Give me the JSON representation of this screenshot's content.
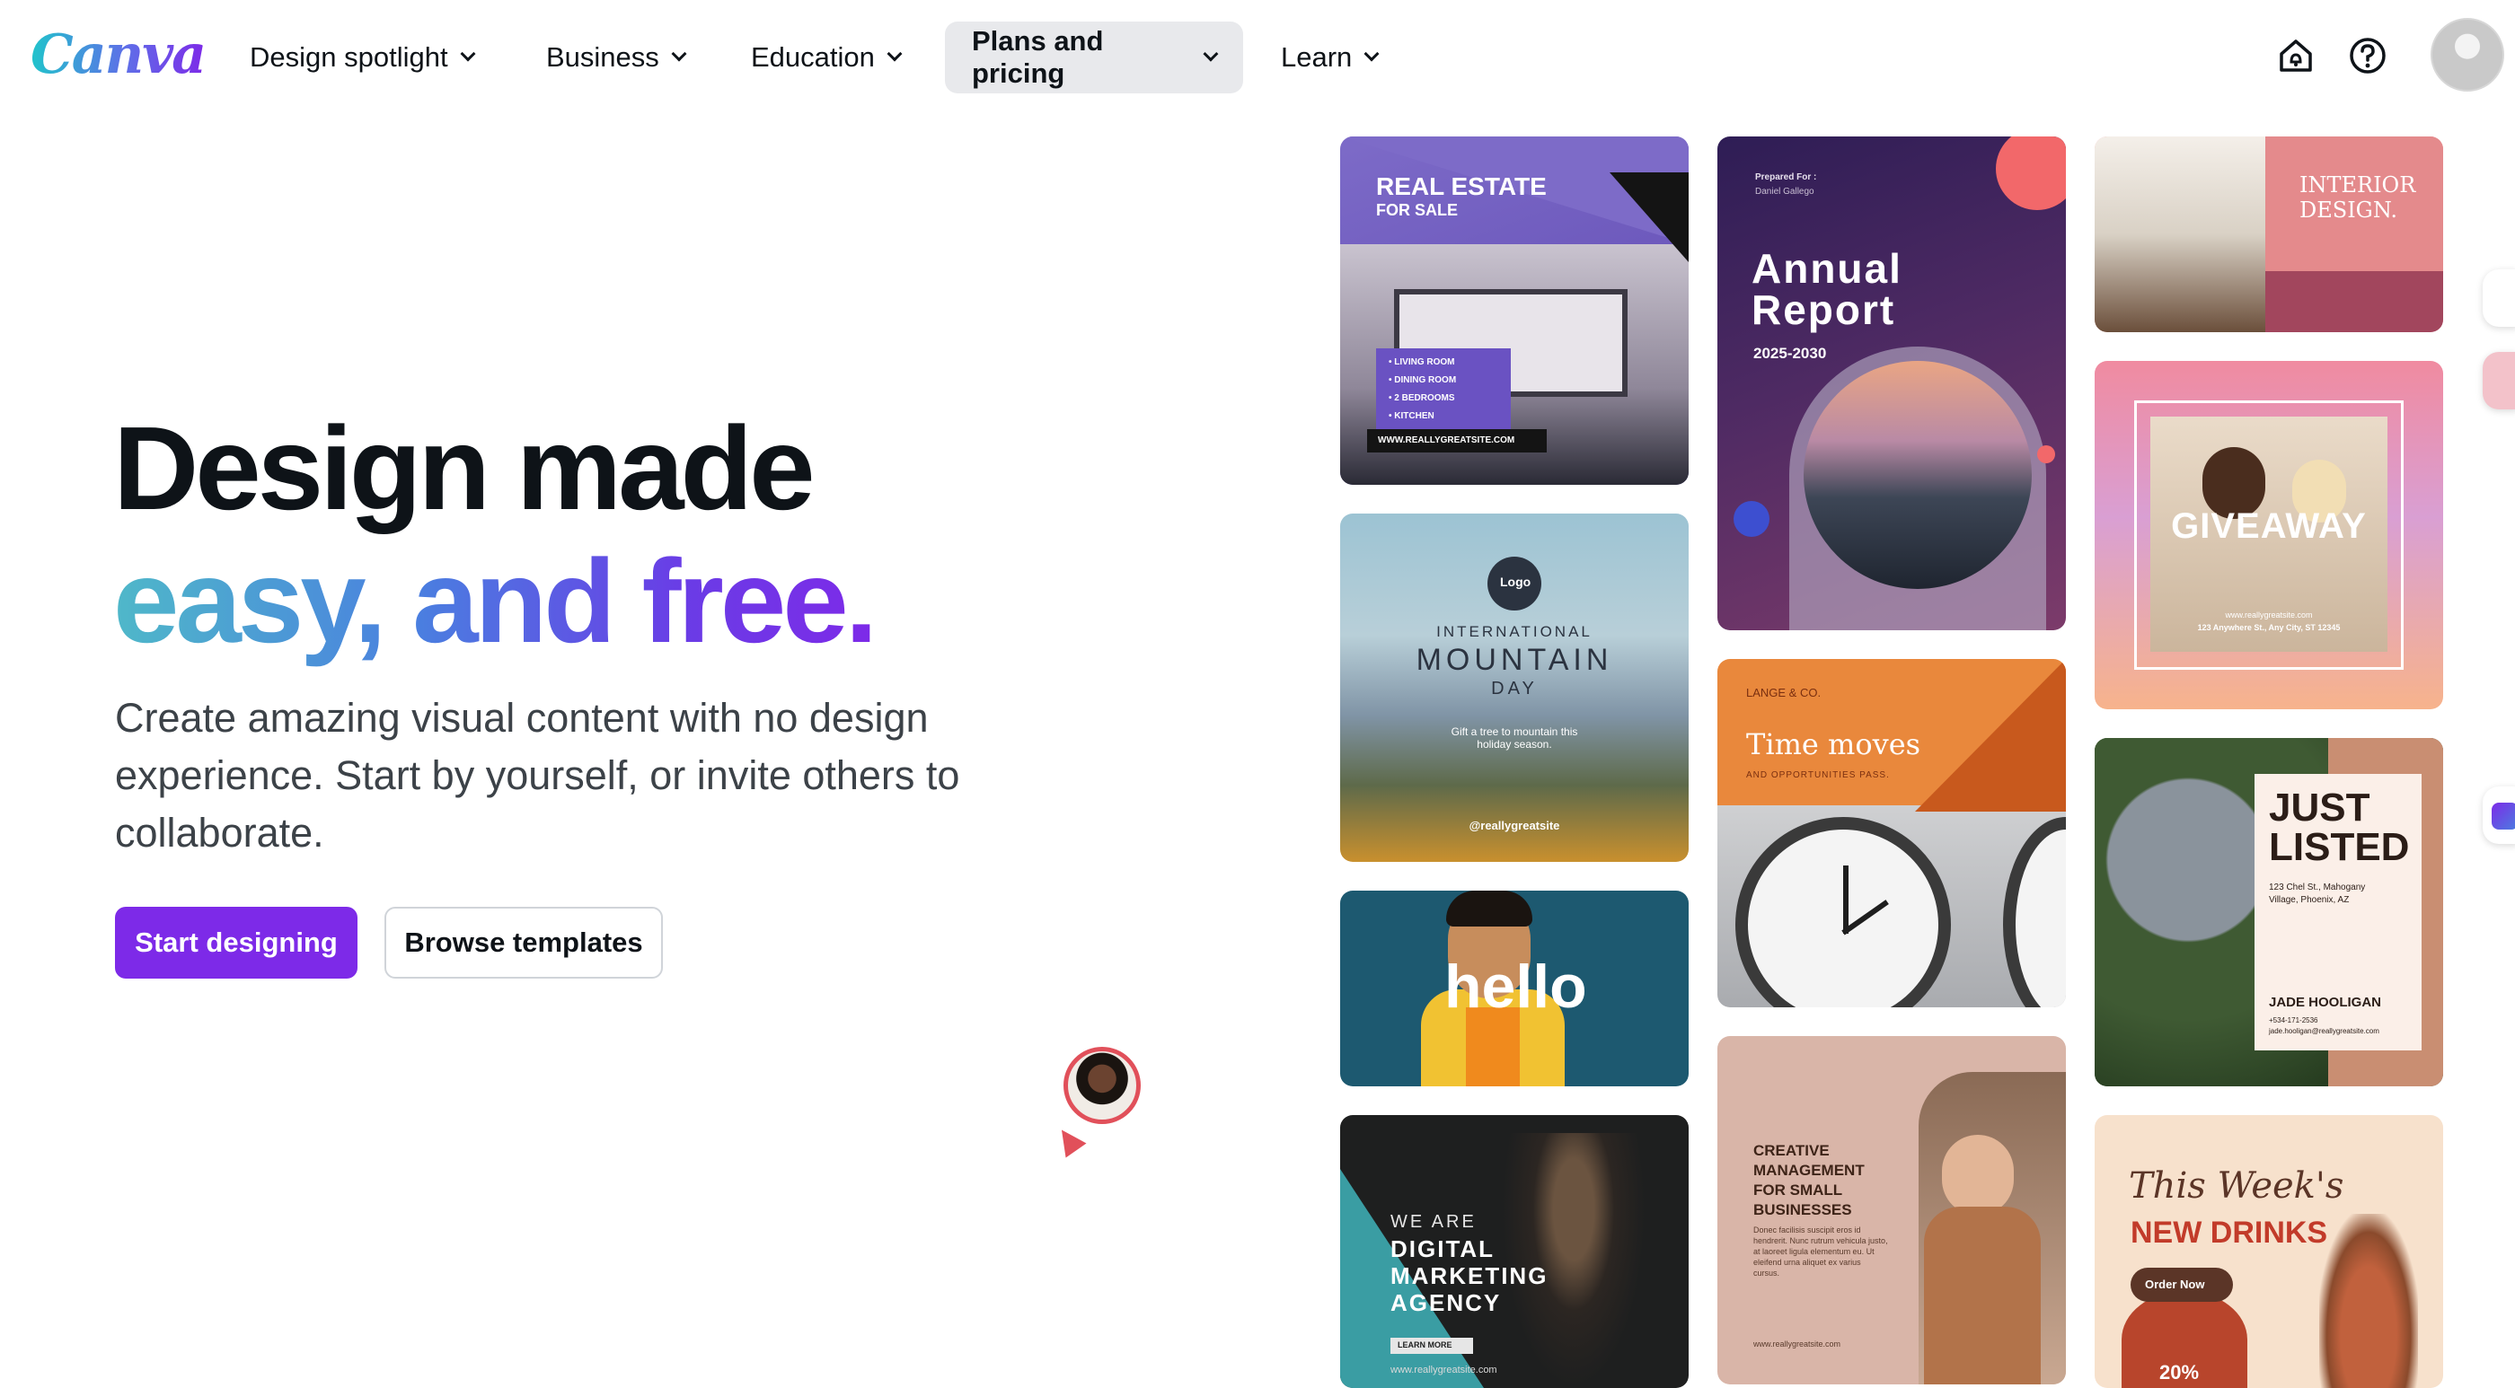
{
  "brand": {
    "logo_text": "Canva"
  },
  "nav": {
    "items": [
      {
        "label": "Design spotlight",
        "has_dropdown": true,
        "active": false
      },
      {
        "label": "Business",
        "has_dropdown": true,
        "active": false
      },
      {
        "label": "Education",
        "has_dropdown": true,
        "active": false
      },
      {
        "label": "Plans and pricing",
        "has_dropdown": true,
        "active": true
      },
      {
        "label": "Learn",
        "has_dropdown": true,
        "active": false
      }
    ],
    "icons": [
      "home-notification-icon",
      "help-icon"
    ],
    "avatar": "user-avatar"
  },
  "hero": {
    "line1": "Design made",
    "line2": "easy, and free.",
    "subtitle": "Create amazing visual content with no design experience. Start by yourself, or invite others to collaborate.",
    "primary_cta": "Start designing",
    "secondary_cta": "Browse templates"
  },
  "templates": {
    "real_estate": {
      "title": "REAL ESTATE",
      "subtitle": "FOR SALE",
      "bullets": [
        "• LIVING ROOM",
        "• DINING ROOM",
        "• 2 BEDROOMS",
        "• KITCHEN"
      ],
      "url": "WWW.REALLYGREATSITE.COM"
    },
    "mountain": {
      "logo": "Logo",
      "line1": "INTERNATIONAL",
      "line2": "MOUNTAIN",
      "line3": "DAY",
      "tagline": "Gift a tree to mountain this holiday season.",
      "handle": "@reallygreatsite"
    },
    "hello": {
      "text": "hello"
    },
    "agency": {
      "line1": "WE ARE",
      "line2": "DIGITAL",
      "line3": "MARKETING",
      "line4": "AGENCY",
      "cta": "LEARN MORE",
      "url": "www.reallygreatsite.com"
    },
    "annual_report": {
      "prepared_for": "Prepared For :",
      "name": "Daniel Gallego",
      "title1": "Annual",
      "title2": "Report",
      "years": "2025-2030"
    },
    "time_moves": {
      "brand": "LANGE & CO.",
      "title": "Time moves",
      "subtitle": "AND OPPORTUNITIES PASS."
    },
    "creative": {
      "line1": "CREATIVE",
      "line2": "MANAGEMENT",
      "line3": "FOR SMALL",
      "line4": "BUSINESSES",
      "body": "Donec facilisis suscipit eros id hendrerit. Nunc rutrum vehicula justo, at laoreet ligula elementum eu. Ut eleifend urna aliquet ex varius cursus.",
      "url": "www.reallygreatsite.com"
    },
    "interior": {
      "title1": "INTERIOR",
      "title2": "DESIGN."
    },
    "giveaway": {
      "title": "GIVEAWAY",
      "url": "www.reallygreatsite.com",
      "address": "123 Anywhere St., Any City, ST 12345"
    },
    "just_listed": {
      "title1": "JUST",
      "title2": "LISTED",
      "address": "123 Chel St., Mahogany Village, Phoenix, AZ",
      "agent": "JADE HOOLIGAN",
      "phone": "+534-171-2536",
      "email": "jade.hooligan@reallygreatsite.com"
    },
    "drinks": {
      "line1": "This Week's",
      "line2": "NEW DRINKS",
      "cta": "Order Now",
      "badge": "20%"
    }
  },
  "colors": {
    "primary": "#7d2ae8",
    "nav_active_bg": "#e8e9ec",
    "text": "#0e1318"
  }
}
